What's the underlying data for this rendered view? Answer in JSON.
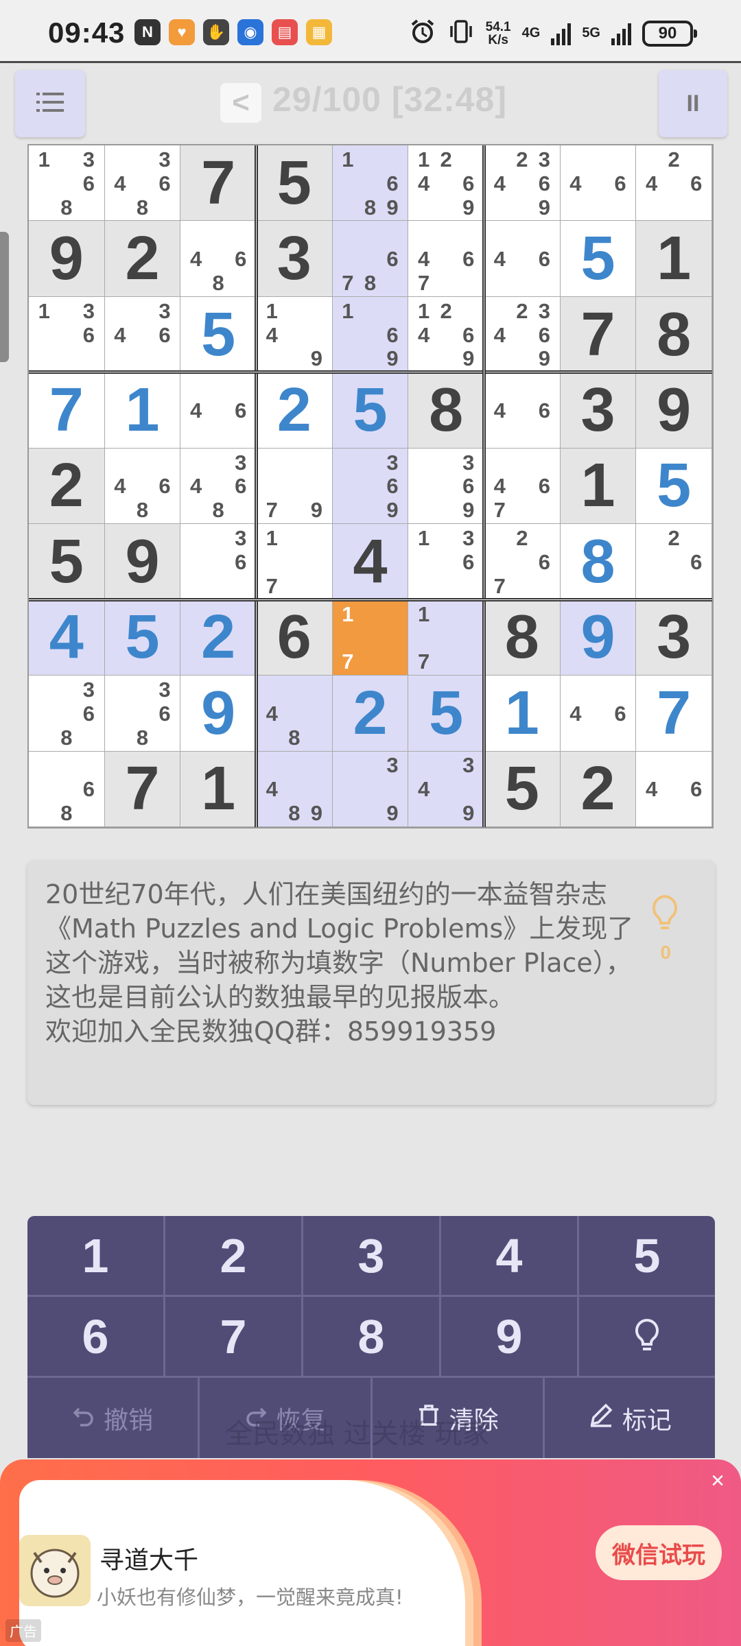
{
  "status_bar": {
    "time": "09:43",
    "net_speed_value": "54.1",
    "net_speed_unit": "K/s",
    "network_1": "4G",
    "network_2": "5G",
    "battery": "90",
    "apps": [
      {
        "icon": "nfc-icon",
        "color": "#333333",
        "glyph": "N"
      },
      {
        "icon": "heart-app-icon",
        "color": "#f39a3b",
        "glyph": "♥"
      },
      {
        "icon": "hand-app-icon",
        "color": "#444444",
        "glyph": "✋"
      },
      {
        "icon": "browser-app-icon",
        "color": "#2a73d9",
        "glyph": "◉"
      },
      {
        "icon": "book-app-icon",
        "color": "#e8504f",
        "glyph": "▤"
      },
      {
        "icon": "sticker-app-icon",
        "color": "#f3b83a",
        "glyph": "▦"
      }
    ]
  },
  "header": {
    "back_label": "<",
    "progress": "29/100 [32:48]",
    "pause_label": "II"
  },
  "board": {
    "cells": [
      [
        {
          "n": [
            1,
            3,
            6,
            8
          ]
        },
        {
          "n": [
            3,
            4,
            6,
            8
          ]
        },
        {
          "v": 7,
          "g": true
        },
        {
          "v": 5,
          "g": true
        },
        {
          "n": [
            1,
            6,
            8,
            9
          ],
          "hl": true
        },
        {
          "n": [
            1,
            2,
            4,
            6,
            9
          ]
        },
        {
          "n": [
            2,
            3,
            4,
            6,
            9
          ]
        },
        {
          "n": [
            4,
            6
          ]
        },
        {
          "n": [
            2,
            4,
            6
          ]
        }
      ],
      [
        {
          "v": 9,
          "g": true
        },
        {
          "v": 2,
          "g": true
        },
        {
          "n": [
            4,
            6,
            8
          ]
        },
        {
          "v": 3,
          "g": true
        },
        {
          "n": [
            6,
            7,
            8
          ],
          "hl": true
        },
        {
          "n": [
            4,
            6,
            7
          ]
        },
        {
          "n": [
            4,
            6
          ]
        },
        {
          "v": 5,
          "u": true
        },
        {
          "v": 1,
          "g": true
        }
      ],
      [
        {
          "n": [
            1,
            3,
            6
          ]
        },
        {
          "n": [
            3,
            4,
            6
          ]
        },
        {
          "v": 5,
          "u": true
        },
        {
          "n": [
            1,
            4,
            9
          ]
        },
        {
          "n": [
            1,
            6,
            9
          ],
          "hl": true
        },
        {
          "n": [
            1,
            2,
            4,
            6,
            9
          ]
        },
        {
          "n": [
            2,
            3,
            4,
            6,
            9
          ]
        },
        {
          "v": 7,
          "g": true
        },
        {
          "v": 8,
          "g": true
        }
      ],
      [
        {
          "v": 7,
          "u": true
        },
        {
          "v": 1,
          "u": true
        },
        {
          "n": [
            4,
            6
          ]
        },
        {
          "v": 2,
          "u": true
        },
        {
          "v": 5,
          "u": true,
          "hl": true
        },
        {
          "v": 8,
          "g": true
        },
        {
          "n": [
            4,
            6
          ]
        },
        {
          "v": 3,
          "g": true
        },
        {
          "v": 9,
          "g": true
        }
      ],
      [
        {
          "v": 2,
          "g": true
        },
        {
          "n": [
            4,
            6,
            8
          ]
        },
        {
          "n": [
            3,
            4,
            6,
            8
          ]
        },
        {
          "n": [
            7,
            9
          ]
        },
        {
          "n": [
            3,
            6,
            9
          ],
          "hl": true
        },
        {
          "n": [
            3,
            6,
            9
          ]
        },
        {
          "n": [
            4,
            6,
            7
          ]
        },
        {
          "v": 1,
          "g": true
        },
        {
          "v": 5,
          "u": true
        }
      ],
      [
        {
          "v": 5,
          "g": true
        },
        {
          "v": 9,
          "g": true
        },
        {
          "n": [
            3,
            6
          ]
        },
        {
          "n": [
            1,
            7
          ]
        },
        {
          "v": 4,
          "g": true,
          "hl": true
        },
        {
          "n": [
            1,
            3,
            6
          ]
        },
        {
          "n": [
            2,
            6,
            7
          ]
        },
        {
          "v": 8,
          "u": true
        },
        {
          "n": [
            2,
            6
          ]
        }
      ],
      [
        {
          "v": 4,
          "u": true,
          "hl": true
        },
        {
          "v": 5,
          "u": true,
          "hl": true
        },
        {
          "v": 2,
          "u": true,
          "hl": true
        },
        {
          "v": 6,
          "g": true
        },
        {
          "n": [
            1,
            7
          ],
          "sel": true
        },
        {
          "n": [
            1,
            7
          ],
          "hl": true
        },
        {
          "v": 8,
          "g": true
        },
        {
          "v": 9,
          "u": true,
          "hl": true
        },
        {
          "v": 3,
          "g": true
        }
      ],
      [
        {
          "n": [
            3,
            6,
            8
          ]
        },
        {
          "n": [
            3,
            6,
            8
          ]
        },
        {
          "v": 9,
          "u": true
        },
        {
          "n": [
            4,
            8
          ],
          "hl": true
        },
        {
          "v": 2,
          "u": true,
          "hl": true
        },
        {
          "v": 5,
          "u": true,
          "hl": true
        },
        {
          "v": 1,
          "u": true
        },
        {
          "n": [
            4,
            6
          ]
        },
        {
          "v": 7,
          "u": true
        }
      ],
      [
        {
          "n": [
            6,
            8
          ]
        },
        {
          "v": 7,
          "g": true
        },
        {
          "v": 1,
          "g": true
        },
        {
          "n": [
            4,
            8,
            9
          ],
          "hl": true
        },
        {
          "n": [
            3,
            9
          ],
          "hl": true
        },
        {
          "n": [
            3,
            4,
            9
          ],
          "hl": true
        },
        {
          "v": 5,
          "g": true
        },
        {
          "v": 2,
          "g": true
        },
        {
          "n": [
            4,
            6
          ]
        }
      ]
    ]
  },
  "info": {
    "text": "20世纪70年代，人们在美国纽约的一本益智杂志《Math Puzzles and Logic Problems》上发现了这个游戏，当时被称为填数字（Number Place），这也是目前公认的数独最早的见报版本。\n欢迎加入全民数独QQ群：859919359",
    "hint_count": "0"
  },
  "keypad": {
    "numbers_row1": [
      "1",
      "2",
      "3",
      "4",
      "5"
    ],
    "numbers_row2": [
      "6",
      "7",
      "8",
      "9"
    ],
    "undo_label": "撤销",
    "redo_label": "恢复",
    "clear_label": "清除",
    "mark_label": "标记",
    "overlay_text": "全民数独 过关楼 玩家"
  },
  "ad": {
    "title": "寻道大千",
    "subtitle": "小妖也有修仙梦，一觉醒来竟成真!",
    "cta": "微信试玩",
    "close": "×",
    "label": "广告"
  },
  "colors": {
    "accent_blue": "#3e86cc",
    "selected_cell": "#f29a3f",
    "highlight_cell": "#dcdcf7",
    "keypad_bg": "#514c76"
  }
}
